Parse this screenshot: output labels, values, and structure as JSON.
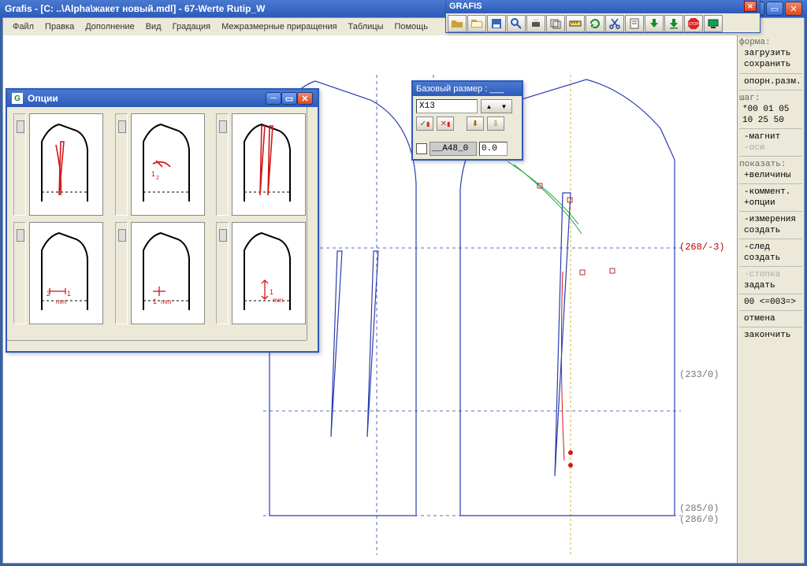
{
  "os_title": "Grafis - [C: ..\\Alpha\\жакет новый.mdl] - 67-Werte Rutip_W",
  "menubar": [
    "Файл",
    "Правка",
    "Дополнение",
    "Вид",
    "Градация",
    "Межразмерные приращения",
    "Таблицы",
    "Помощь"
  ],
  "float_toolbar": {
    "title": "GRAFIS"
  },
  "options_window": {
    "title": "Опции",
    "icon_text": "G"
  },
  "bs_window": {
    "title": "Базовый размер : ___",
    "size_field": "X13",
    "param_name": "__A48_0",
    "param_value": "0.0"
  },
  "right_panel": {
    "form_label": "форма:",
    "load": "загрузить",
    "save": "сохранить",
    "opor": "опорн.разм.",
    "step_label": "шаг:",
    "step_row1": "*00  01  05",
    "step_row2": " 10  25  50",
    "magnet": "-магнит",
    "axes": "-оси",
    "show_label": "показать:",
    "show_vals": "+величины",
    "comment": "-коммент.",
    "options": "+опции",
    "meas": "-измерения",
    "create1": "создать",
    "trace": "-след",
    "create2": "создать",
    "stack": "-стопка",
    "set": "задать",
    "paging": "00 <=003=>",
    "cancel": "отмена",
    "finish": "закончить"
  },
  "canvas_labels": {
    "p1": "(268/-3)",
    "p2": "(233/0)",
    "p3": "(285/0)",
    "p4": "(286/0)"
  },
  "thumb_annotations": {
    "t4a": "2",
    "t4b": "1",
    "t4c": "mm",
    "t5a": "1",
    "t5b": "mm",
    "t6a": "1",
    "t6b": "mm"
  }
}
